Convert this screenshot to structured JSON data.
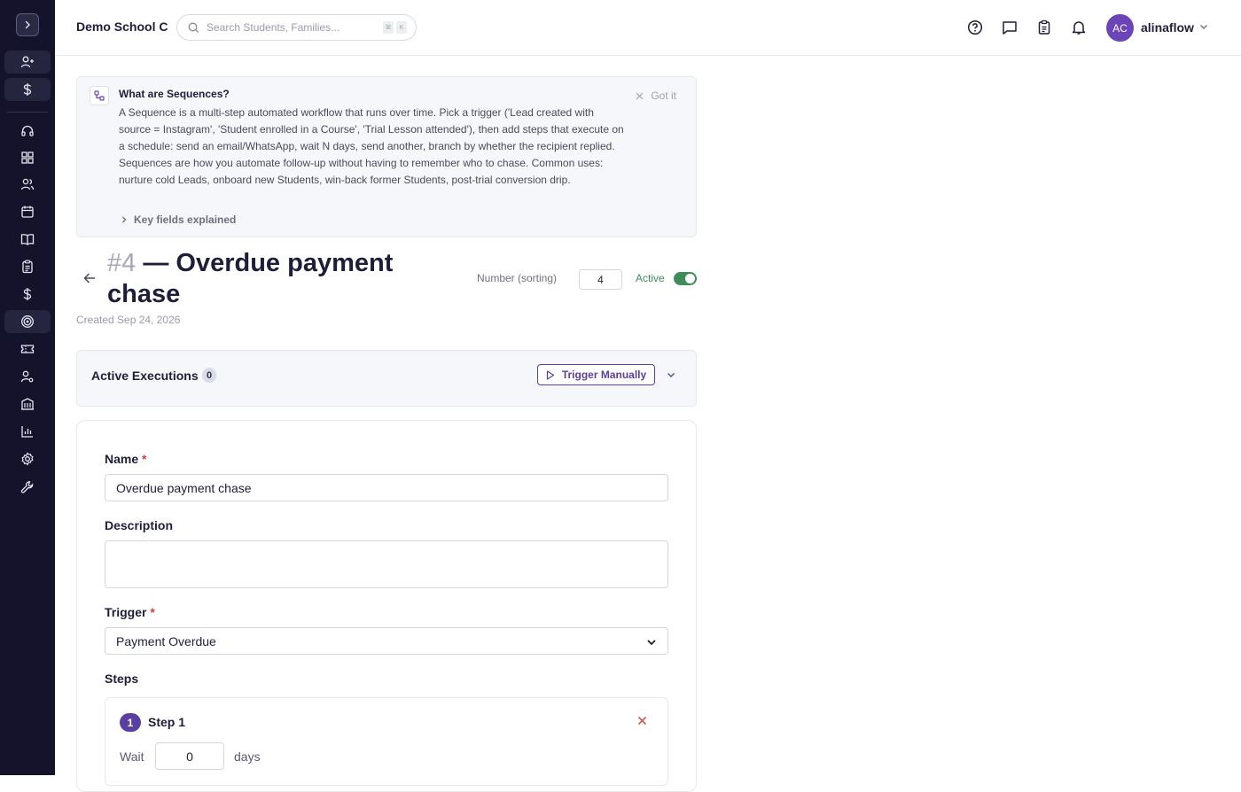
{
  "sidebar": {
    "items": [
      {
        "icon": "user-plus-icon"
      },
      {
        "icon": "dollar-icon"
      },
      {
        "icon": "headset-icon"
      },
      {
        "icon": "dashboard-icon"
      },
      {
        "icon": "users-icon"
      },
      {
        "icon": "calendar-icon"
      },
      {
        "icon": "book-icon"
      },
      {
        "icon": "clipboard-icon"
      },
      {
        "icon": "dollar-icon"
      },
      {
        "icon": "target-icon"
      },
      {
        "icon": "ticket-icon"
      },
      {
        "icon": "user-settings-icon"
      },
      {
        "icon": "building-icon"
      },
      {
        "icon": "bar-chart-icon"
      },
      {
        "icon": "gear-icon"
      },
      {
        "icon": "wrench-icon"
      }
    ]
  },
  "header": {
    "school": "Demo School C",
    "search_placeholder": "Search Students, Families...",
    "shortcut_keys": [
      "⌘",
      "K"
    ],
    "user_initials": "AC",
    "user_name": "alinaflow"
  },
  "info": {
    "title": "What are Sequences?",
    "body": "A Sequence is a multi-step automated workflow that runs over time. Pick a trigger ('Lead created with source = Instagram', 'Student enrolled in a Course', 'Trial Lesson attended'), then add steps that execute on a schedule: send an email/WhatsApp, wait N days, send another, branch by whether the recipient replied. Sequences are how you automate follow-up without having to remember who to chase. Common uses: nurture cold Leads, onboard new Students, win-back former Students, post-trial conversion drip.",
    "dismiss": "Got it",
    "key_fields": "Key fields explained"
  },
  "sequence": {
    "number": "#4",
    "title": "— Overdue payment chase",
    "created": "Created Sep 24, 2026",
    "number_label": "Number (sorting)",
    "number_value": "4",
    "active_label": "Active",
    "active": true
  },
  "executions": {
    "title": "Active Executions",
    "count": "0",
    "trigger_button": "Trigger Manually"
  },
  "form": {
    "name_label": "Name",
    "name_value": "Overdue payment chase",
    "description_label": "Description",
    "description_value": "",
    "trigger_label": "Trigger",
    "trigger_value": "Payment Overdue",
    "steps_label": "Steps",
    "required_mark": "*"
  },
  "steps": [
    {
      "number": "1",
      "title": "Step 1",
      "wait_label": "Wait",
      "wait_value": "0",
      "unit": "days"
    }
  ],
  "colors": {
    "sidebar_bg": "#14132b",
    "accent": "#5b3fa0",
    "active_green": "#3d8c5a",
    "required_red": "#d1453b"
  }
}
